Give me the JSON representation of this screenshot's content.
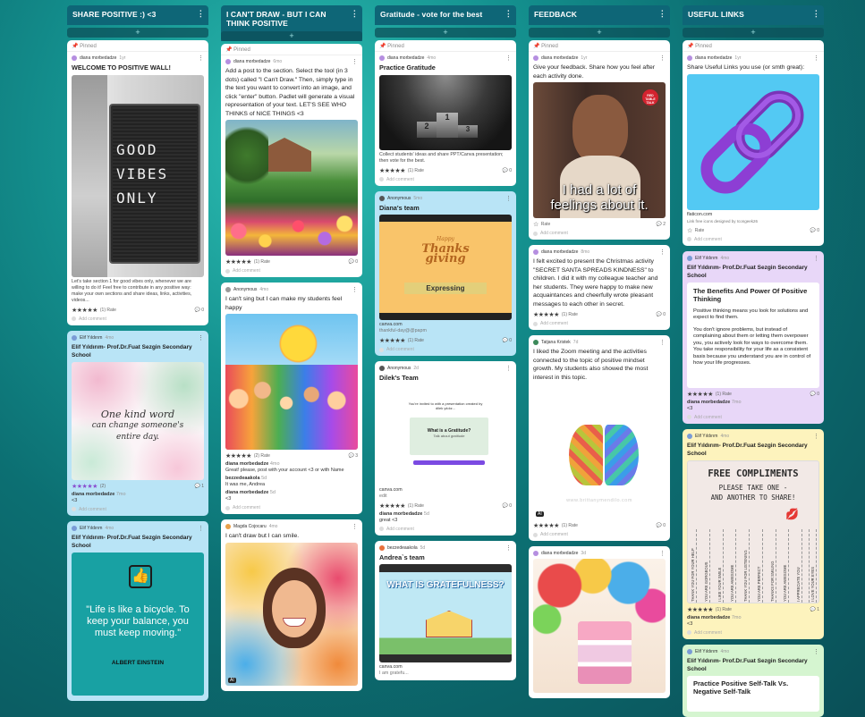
{
  "columns": [
    {
      "title": "SHARE  POSITIVE :) <3"
    },
    {
      "title": "I CAN'T DRAW - BUT I CAN THINK POSITIVE"
    },
    {
      "title": "Gratitude  - vote for the best"
    },
    {
      "title": "FEEDBACK"
    },
    {
      "title": "USEFUL LINKS"
    }
  ],
  "ui": {
    "add": "+",
    "pinned": "Pinned",
    "rate": "Rate",
    "add_comment": "Add comment",
    "more": "⋮"
  },
  "c1": {
    "p1": {
      "author": "diana morbedadze",
      "time": "1yr",
      "title": "WELCOME TO POSITIVE WALL!",
      "sign": [
        "GOOD",
        "VIBES",
        "ONLY"
      ],
      "text": "Let's take section 1 for good vibes only, whenever we are willing to do it! Feel free to contribute in any positive way: make your own sections and share ideas, links, activities, videos...",
      "rating": "(1) Rate",
      "comments": "0"
    },
    "p2": {
      "author": "Elif Yıldırım",
      "time": "4mo",
      "title": "Elif Yıldırım- Prof.Dr.Fuat Sezgin Secondary School",
      "quote1": "One kind word",
      "quote2": "can change someone's",
      "quote3": "entire day.",
      "rating": "(2)",
      "comments": "1",
      "reply_author": "diana morbedadze",
      "reply_time": "7mo",
      "reply_text": "<3"
    },
    "p3": {
      "author": "Elif Yıldırım",
      "time": "4mo",
      "title": "Elif Yıldırım- Prof.Dr.Fuat Sezgin Secondary School",
      "quote": "\"Life is like a bicycle. To keep your balance, you must keep moving.\"",
      "quote_by": "ALBERT EINSTEIN"
    }
  },
  "c2": {
    "p1": {
      "author": "diana morbedadze",
      "time": "6mo",
      "text": "Add a post to the section. Select the tool (in 3 dots) called \"I Can't Draw.\" Then, simply type in the text you want to convert into an image, and click \"enter\" button. Padlet will generate a visual representation of your text. LET'S SEE WHO THINKS  of NICE THINGS  <3",
      "rating": "(1) Rate",
      "comments": "0"
    },
    "p2": {
      "author": "Anonymous",
      "time": "4mo",
      "text": "I can't sing but I can make my students feel happy",
      "rating": "(2) Rate",
      "comments": "3",
      "replies": [
        {
          "author": "diana morbedadze",
          "time": "4mo",
          "text": "Great! please, post with your account <3 or with Name"
        },
        {
          "author": "bezzedeaakola",
          "time": "5d",
          "text": "It was me, Andrea"
        },
        {
          "author": "diana morbedadze",
          "time": "5d",
          "text": "<3"
        }
      ]
    },
    "p3": {
      "author": "Magda Cojocaru",
      "time": "4mo",
      "text": "I can't draw but I can smile.",
      "badge": "AI"
    }
  },
  "c3": {
    "p1": {
      "author": "diana morbedadze",
      "time": "4mo",
      "title": "Practice Gratitude",
      "text": "Collect students' ideas and share PPT/Canva presentation;  then vote for the best.",
      "rating": "(1) Rate",
      "comments": "0"
    },
    "p2": {
      "author": "Anonymous",
      "time": "5mo",
      "title": "Diana's team",
      "word1": "Happy",
      "word2": "Thanks",
      "word3": "giving",
      "banner": "Expressing",
      "source": "canva.com",
      "link": "thankful-day@@papm",
      "rating": "(1) Rate",
      "comments": "0"
    },
    "p3": {
      "author": "Anonymous",
      "time": "2d",
      "title": "Dilek's Team",
      "invite": "You're invited to with a presentation created by dilek yıldız...",
      "mini_title": "What is a Gratitude?",
      "mini_sub": "Talk about gratitude",
      "source": "canva.com",
      "edit": "edit",
      "rating": "(1) Rate",
      "comments": "0",
      "reply_author": "diana morbedadze",
      "reply_time": "5d",
      "reply_text": "great <3"
    },
    "p4": {
      "author": "bezzedeaakola",
      "time": "5d",
      "title": "Andrea`s team",
      "question": "WHAT IS GRATEFULNESS?",
      "source": "canva.com",
      "caption": "I am gratefu..."
    }
  },
  "c4": {
    "p1": {
      "author": "diana morbedadze",
      "time": "1yr",
      "text": "Give your feedback. Share how you feel after each activity done.",
      "caption1": "I had a lot of",
      "caption2": "feelings about it.",
      "badge": "RED TABLE TALK",
      "rating": "Rate",
      "comments": "2"
    },
    "p2": {
      "author": "diana morbedadze",
      "time": "8mo",
      "text": "I felt excited to  present the Christmas activity \"SECRET SANTA SPREADS KINDNESS\" to children. I did it with my colleague teacher and her students. They were happy to make new acquaintances and cheerfully wrote pleasant messages to each other in secret.",
      "rating": "(1) Rate",
      "comments": "0"
    },
    "p3": {
      "author": "Tatjana Kristek",
      "time": "7d",
      "text": "I liked the Zoom meeting and the activities connected to the topic of positive mindset growth. My students also showed the most interest in this topic.",
      "watermark": "www.brittanymendilo.com",
      "badge": "AI",
      "rating": "(1) Rate",
      "comments": "0"
    },
    "p4": {
      "author": "diana morbedadze",
      "time": "3d"
    }
  },
  "c5": {
    "p1": {
      "author": "diana morbedadze",
      "time": "1yr",
      "text": "Share Useful Links you use (or smth great):",
      "source": "flaticon.com",
      "desc": "Link free icons designed by Icongeek26",
      "rating": "Rate",
      "comments": "0"
    },
    "p2": {
      "author": "Elif Yıldırım",
      "time": "4mo",
      "title": "Elif Yıldırım- Prof.Dr.Fuat Sezgin Secondary School",
      "doc_title": "The Benefits And Power Of Positive Thinking",
      "doc_p1": "Positive thinking means you look for solutions and expect to find them.",
      "doc_p2": "You don't ignore problems, but instead of complaining about them or letting them overpower you, you actively look for ways to overcome them. You take responsibility for your life as a consistent basis because you understand you are in control of how your life progresses.",
      "rating": "(1) Rate",
      "comments": "0",
      "reply_author": "diana morbedadze",
      "reply_time": "7mo",
      "reply_text": "<3"
    },
    "p3": {
      "author": "Elif Yıldırım",
      "time": "4mo",
      "title": "Elif Yıldırım- Prof.Dr.Fuat Sezgin Secondary School",
      "poster_title": "FREE COMPLIMENTS",
      "poster_sub1": "PLEASE TAKE ONE -",
      "poster_sub2": "AND ANOTHER TO SHARE!",
      "tabs": [
        "THANK YOU FOR YOUR HELP",
        "YOU ARE GORGEOUS",
        "I LIKE YOUR SMILE",
        "YOU ARE AWESOME",
        "THANK YOU FOR LISTENING",
        "YOU ARE PERFECT",
        "THANKS FOR SMILING",
        "YOU ARE AWESOME",
        "I APPRECIATE YOU",
        "I LOVE YOUR EYES"
      ],
      "rating": "(1) Rate",
      "comments": "1",
      "reply_author": "diana morbedadze",
      "reply_time": "7mo",
      "reply_text": "<3"
    },
    "p4": {
      "author": "Elif Yıldırım",
      "time": "4mo",
      "title": "Elif Yıldırım- Prof.Dr.Fuat Sezgin Secondary School",
      "doc_title": "Practice Positive Self-Talk Vs. Negative Self-Talk"
    }
  }
}
